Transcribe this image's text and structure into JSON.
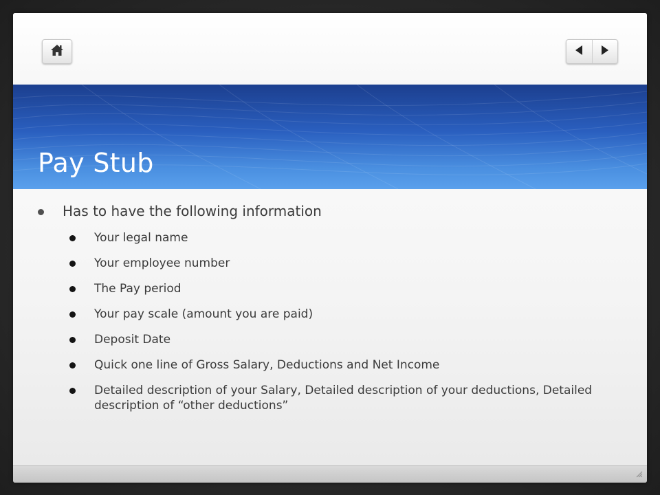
{
  "slide": {
    "title": "Pay Stub",
    "bullets": [
      {
        "level": 1,
        "text": "Has to have the following information"
      },
      {
        "level": 2,
        "text": "Your legal name"
      },
      {
        "level": 2,
        "text": "Your employee number"
      },
      {
        "level": 2,
        "text": "The Pay period"
      },
      {
        "level": 2,
        "text": "Your pay scale (amount you are paid)"
      },
      {
        "level": 2,
        "text": "Deposit Date"
      },
      {
        "level": 2,
        "text": "Quick one line of Gross Salary, Deductions and Net Income"
      },
      {
        "level": 2,
        "text": "Detailed description of your Salary, Detailed description of your deductions, Detailed description of “other deductions”"
      }
    ]
  },
  "nav": {
    "home_icon": "home-icon",
    "prev_icon": "prev-arrow-icon",
    "next_icon": "next-arrow-icon"
  },
  "colors": {
    "banner_dark": "#1c3f8f",
    "banner_light": "#5aa0ec",
    "text": "#3a3a3a"
  }
}
